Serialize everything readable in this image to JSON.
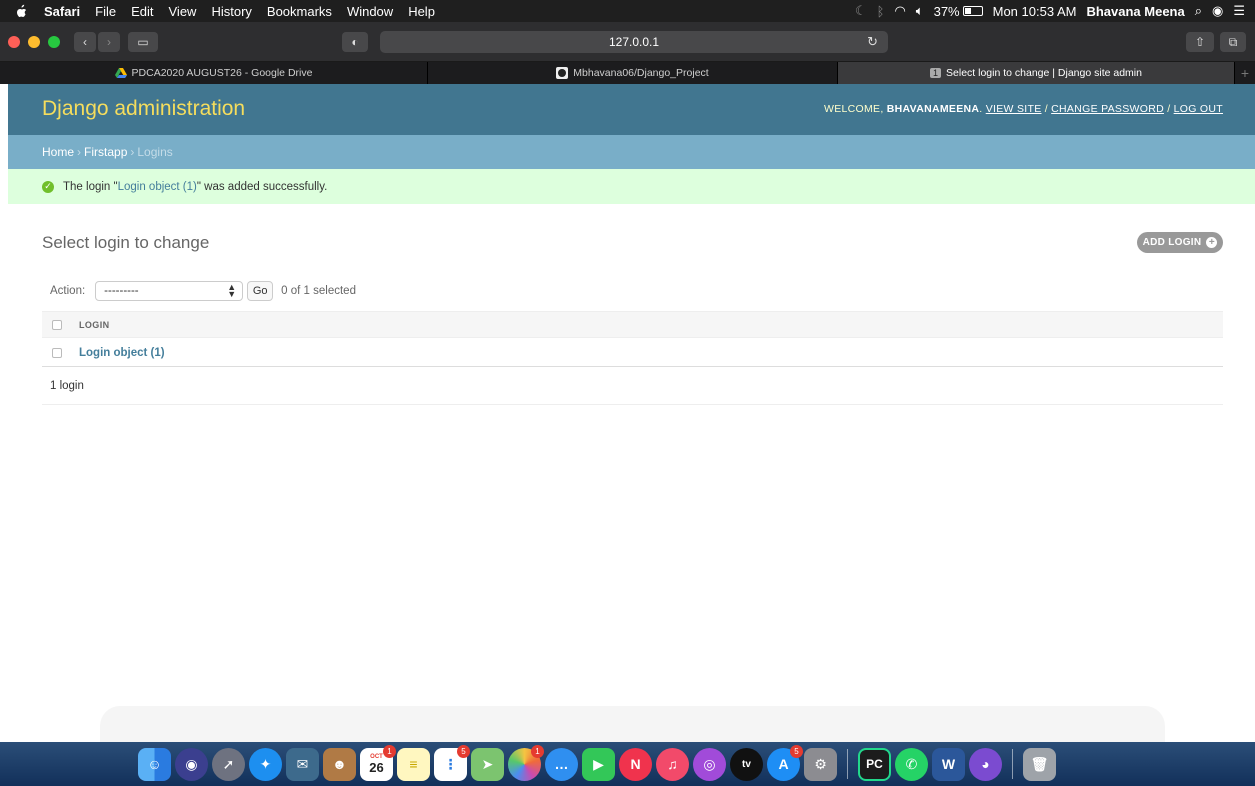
{
  "menubar": {
    "app": "Safari",
    "items": [
      "File",
      "Edit",
      "View",
      "History",
      "Bookmarks",
      "Window",
      "Help"
    ],
    "battery": "37%",
    "clock": "Mon 10:53 AM",
    "user": "Bhavana Meena"
  },
  "browser": {
    "url": "127.0.0.1",
    "tabs": [
      {
        "label": "PDCA2020 AUGUST26 - Google Drive"
      },
      {
        "label": "Mbhavana06/Django_Project"
      },
      {
        "label": "Select login to change | Django site admin",
        "badge": "1"
      }
    ]
  },
  "django": {
    "site_title": "Django administration",
    "user_tools": {
      "welcome": "WELCOME,",
      "username": "BHAVANAMEENA",
      "view_site": "VIEW SITE",
      "change_password": "CHANGE PASSWORD",
      "log_out": "LOG OUT"
    },
    "breadcrumbs": {
      "home": "Home",
      "app": "Firstapp",
      "current": "Logins"
    },
    "message": {
      "prefix": "The login \"",
      "link": "Login object (1)",
      "suffix": "\" was added successfully."
    },
    "page_title": "Select login to change",
    "add_button": "ADD LOGIN",
    "actions": {
      "label": "Action:",
      "selected_option": "---------",
      "go": "Go",
      "counter": "0 of 1 selected"
    },
    "table": {
      "column": "LOGIN",
      "rows": [
        "Login object (1)"
      ]
    },
    "paginator": "1 login"
  },
  "dock": {
    "calendar_month": "OCT",
    "calendar_day": "26",
    "badges": {
      "calendar": "1",
      "reminders": "5",
      "photos": "1",
      "appstore": "5"
    },
    "tv_label": "tv"
  }
}
